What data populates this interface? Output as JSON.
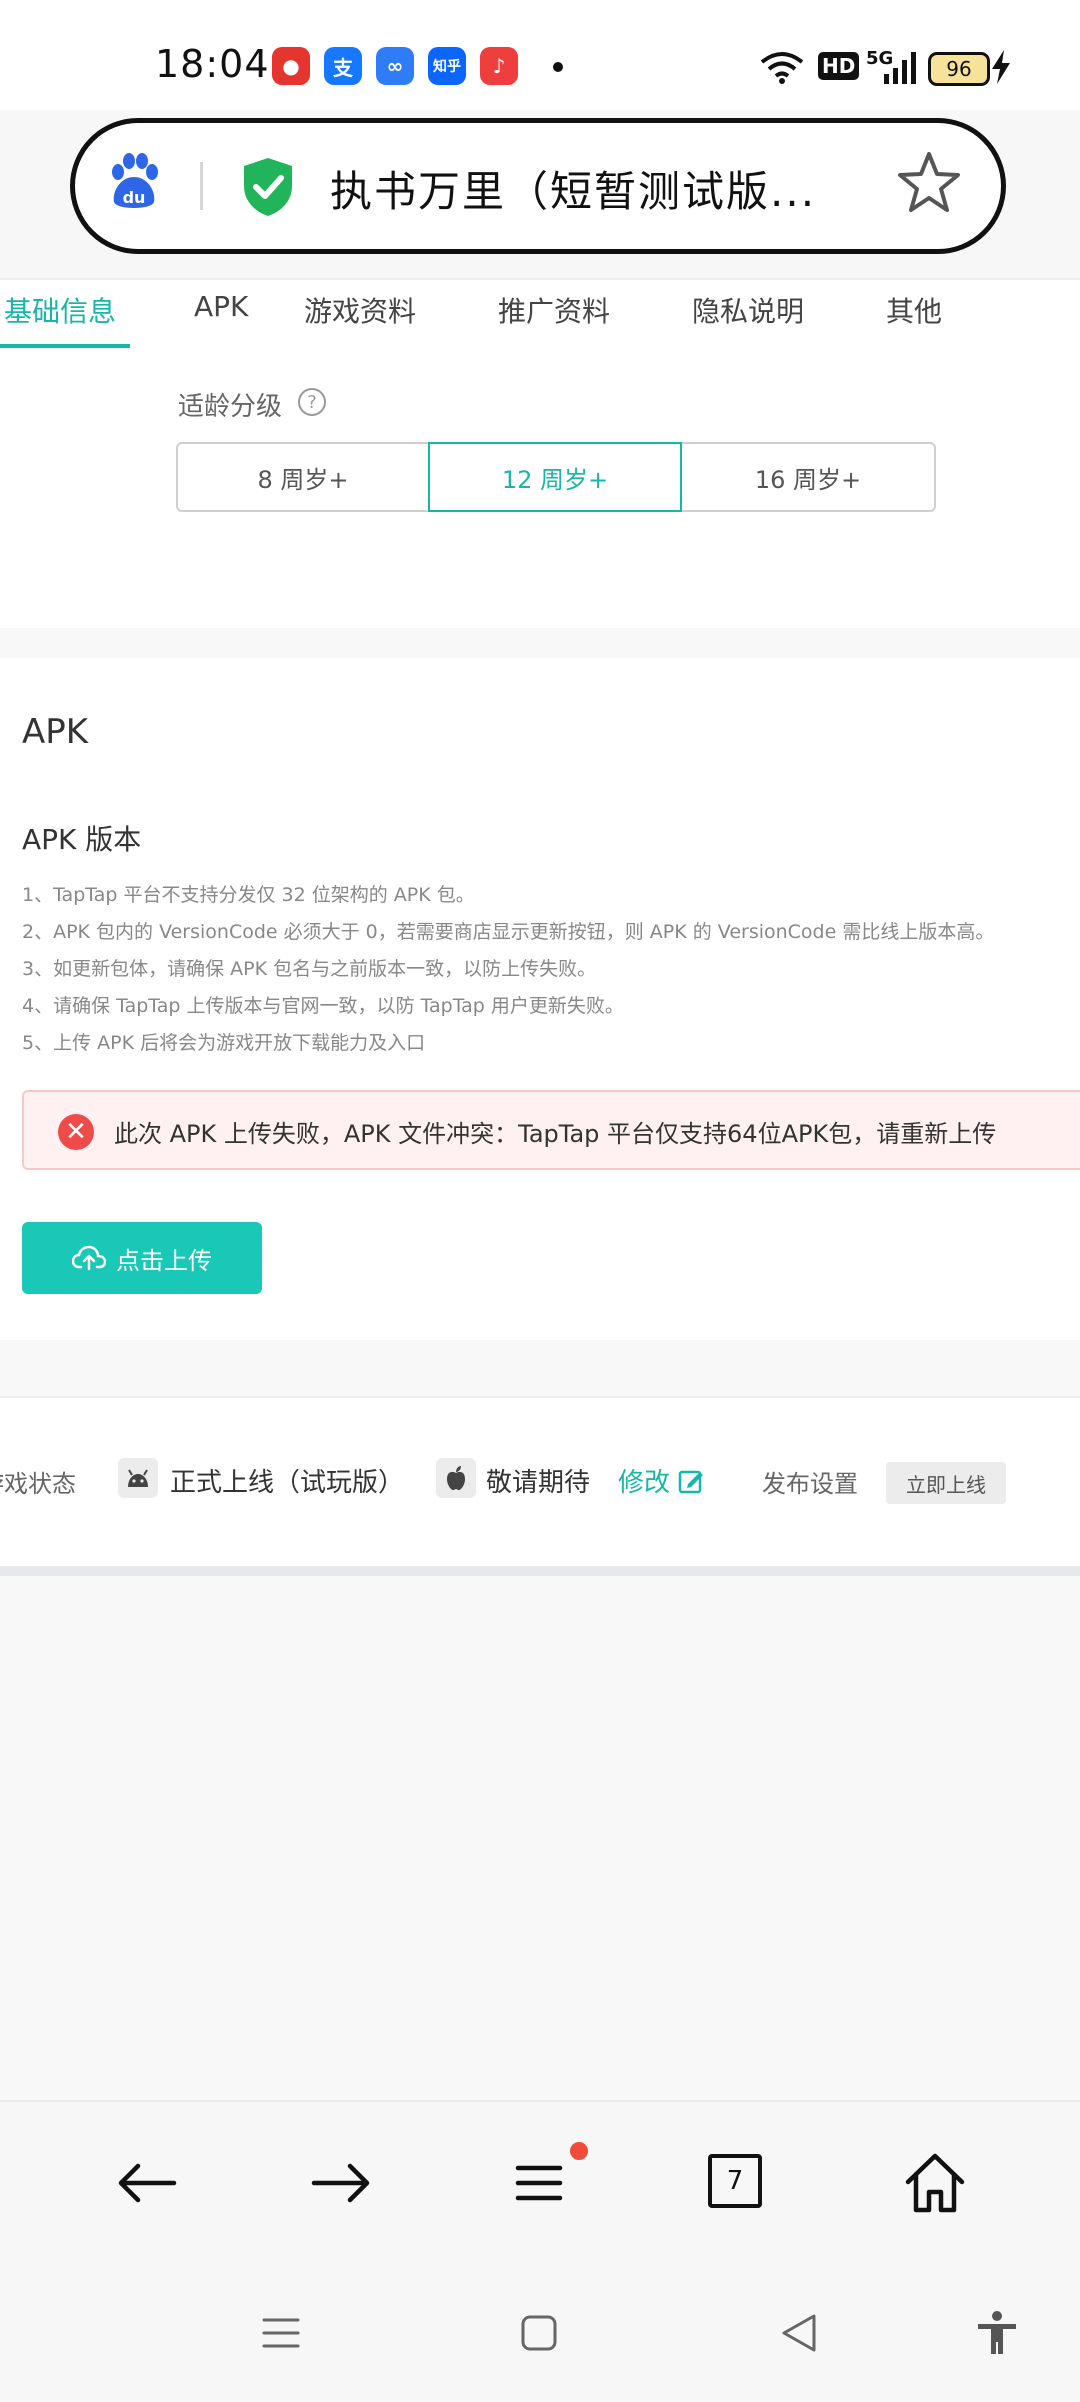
{
  "status_bar": {
    "time": "18:04",
    "app_icons": [
      {
        "name": "red-mascot-icon",
        "glyph": "●",
        "color": "#e5352f"
      },
      {
        "name": "alipay-icon",
        "glyph": "支",
        "color": "#1677ff"
      },
      {
        "name": "infinity-app-icon",
        "glyph": "∞",
        "color": "#2f7df6"
      },
      {
        "name": "zhihu-icon",
        "glyph": "知乎",
        "color": "#0a66ff"
      },
      {
        "name": "music-icon",
        "glyph": "♪",
        "color": "#ef3e3e"
      }
    ],
    "network_hd": "HD",
    "network_5g": "5G",
    "battery_level": "96"
  },
  "browser": {
    "page_title": "执书万里（短暂测试版..."
  },
  "tabs": [
    {
      "label": "基础信息",
      "active": true
    },
    {
      "label": "APK",
      "active": false
    },
    {
      "label": "游戏资料",
      "active": false
    },
    {
      "label": "推广资料",
      "active": false
    },
    {
      "label": "隐私说明",
      "active": false
    },
    {
      "label": "其他",
      "active": false
    }
  ],
  "age_rating": {
    "label": "适龄分级",
    "help": "?",
    "options": [
      "8 周岁+",
      "12 周岁+",
      "16 周岁+"
    ],
    "selected": "12 周岁+"
  },
  "apk": {
    "section_title": "APK",
    "version_title": "APK 版本",
    "notes": [
      "1、TapTap 平台不支持分发仅 32 位架构的 APK 包。",
      "2、APK 包内的 VersionCode 必须大于 0，若需要商店显示更新按钮，则 APK 的 VersionCode 需比线上版本高。",
      "3、如更新包体，请确保 APK 包名与之前版本一致，以防上传失败。",
      "4、请确保 TapTap 上传版本与官网一致，以防 TapTap 用户更新失败。",
      "5、上传 APK 后将会为游戏开放下载能力及入口"
    ],
    "error_message": "此次 APK 上传失败，APK 文件冲突：TapTap 平台仅支持64位APK包，请重新上传",
    "upload_label": "点击上传"
  },
  "game_status": {
    "label": "游戏状态",
    "android_value": "正式上线（试玩版）",
    "ios_value": "敬请期待",
    "edit_label": "修改",
    "publish_label": "发布设置",
    "publish_button": "立即上线"
  },
  "bottom_nav": {
    "tab_count": "7"
  },
  "colors": {
    "accent": "#19b6a8",
    "upload_button": "#19c8b6",
    "error": "#f04b4b",
    "badge": "#f24b3a"
  }
}
